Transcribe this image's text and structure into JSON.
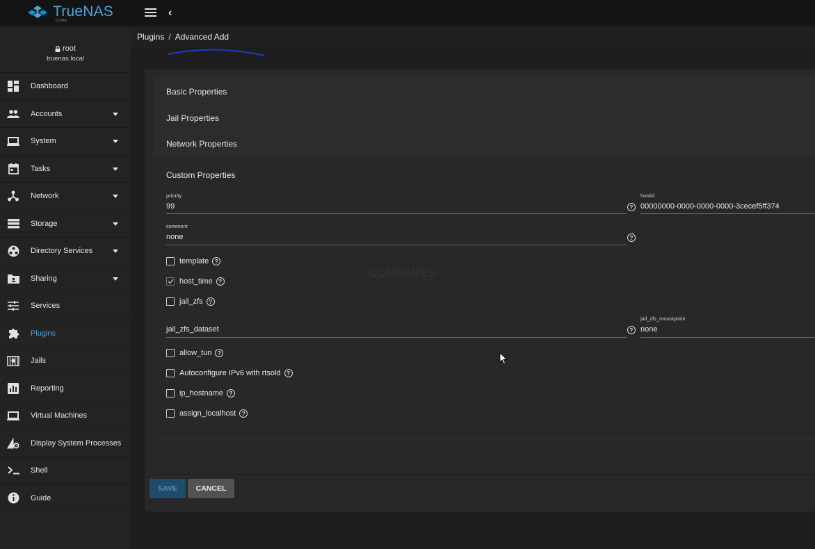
{
  "app": {
    "logo_text": "TrueNAS",
    "logo_sub": "CORE",
    "brand_color": "#4da3d9"
  },
  "user": {
    "name": "root",
    "host": "truenas.local"
  },
  "nav": [
    {
      "label": "Dashboard",
      "icon": "dashboard-icon",
      "expandable": false,
      "active": false
    },
    {
      "label": "Accounts",
      "icon": "accounts-icon",
      "expandable": true,
      "active": false
    },
    {
      "label": "System",
      "icon": "laptop-icon",
      "expandable": true,
      "active": false
    },
    {
      "label": "Tasks",
      "icon": "calendar-icon",
      "expandable": true,
      "active": false
    },
    {
      "label": "Network",
      "icon": "network-icon",
      "expandable": true,
      "active": false
    },
    {
      "label": "Storage",
      "icon": "storage-icon",
      "expandable": true,
      "active": false
    },
    {
      "label": "Directory Services",
      "icon": "directory-icon",
      "expandable": true,
      "active": false
    },
    {
      "label": "Sharing",
      "icon": "folder-share-icon",
      "expandable": true,
      "active": false
    },
    {
      "label": "Services",
      "icon": "sliders-icon",
      "expandable": false,
      "active": false
    },
    {
      "label": "Plugins",
      "icon": "puzzle-icon",
      "expandable": false,
      "active": true
    },
    {
      "label": "Jails",
      "icon": "jail-icon",
      "expandable": false,
      "active": false
    },
    {
      "label": "Reporting",
      "icon": "chart-icon",
      "expandable": false,
      "active": false
    },
    {
      "label": "Virtual Machines",
      "icon": "laptop-icon",
      "expandable": false,
      "active": false
    },
    {
      "label": "Display System Processes",
      "icon": "processes-icon",
      "expandable": false,
      "active": false
    },
    {
      "label": "Shell",
      "icon": "terminal-icon",
      "expandable": false,
      "active": false
    },
    {
      "label": "Guide",
      "icon": "info-icon",
      "expandable": false,
      "active": false
    }
  ],
  "breadcrumb": {
    "parent": "Plugins",
    "separator": "/",
    "current": "Advanced Add"
  },
  "sections": {
    "basic": "Basic Properties",
    "jail": "Jail Properties",
    "network": "Network Properties",
    "custom": "Custom Properties"
  },
  "fields": {
    "priority": {
      "label": "priority",
      "value": "99"
    },
    "hostid": {
      "label": "hostid",
      "value": "00000000-0000-0000-0000-3cecef5ff374"
    },
    "comment": {
      "label": "comment",
      "value": "none"
    },
    "jail_zfs_dataset": {
      "label": "",
      "value": "jail_zfs_dataset"
    },
    "jail_zfs_mountpoint": {
      "label": "jail_zfs_mountpoint",
      "value": "none"
    }
  },
  "checkboxes": {
    "template": {
      "label": "template",
      "checked": false
    },
    "host_time": {
      "label": "host_time",
      "checked": true
    },
    "jail_zfs": {
      "label": "jail_zfs",
      "checked": false
    },
    "allow_tun": {
      "label": "allow_tun",
      "checked": false
    },
    "autoconfigure_ipv6": {
      "label": "Autoconfigure IPv6 with rtsold",
      "checked": false
    },
    "ip_hostname": {
      "label": "ip_hostname",
      "checked": false
    },
    "assign_localhost": {
      "label": "assign_localhost",
      "checked": false
    }
  },
  "buttons": {
    "save": "SAVE",
    "cancel": "CANCEL"
  },
  "help_glyph": "?",
  "watermark": "COMPARES"
}
